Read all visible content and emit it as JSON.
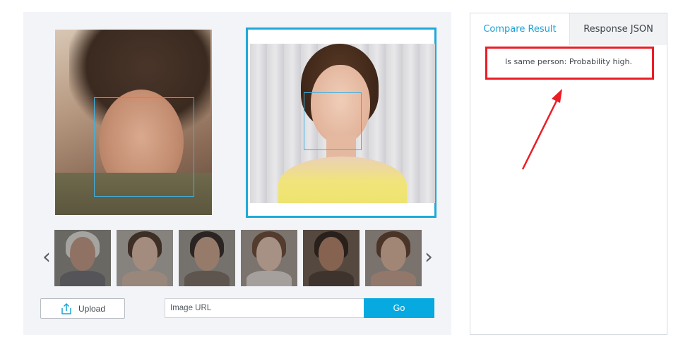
{
  "carousel": {
    "prev_icon": "chevron-left-icon",
    "next_icon": "chevron-right-icon",
    "prev_glyph": "‹",
    "next_glyph": "›"
  },
  "controls": {
    "upload_label": "Upload",
    "upload_icon": "upload-icon",
    "url_placeholder": "Image URL",
    "go_label": "Go"
  },
  "result_panel": {
    "tabs": [
      {
        "label": "Compare Result",
        "active": true
      },
      {
        "label": "Response JSON",
        "active": false
      }
    ],
    "result_text": "Is same person: Probability high."
  },
  "colors": {
    "accent": "#06a9e0",
    "annotation": "#ec1c24",
    "face_box": "#3fb1e3"
  }
}
